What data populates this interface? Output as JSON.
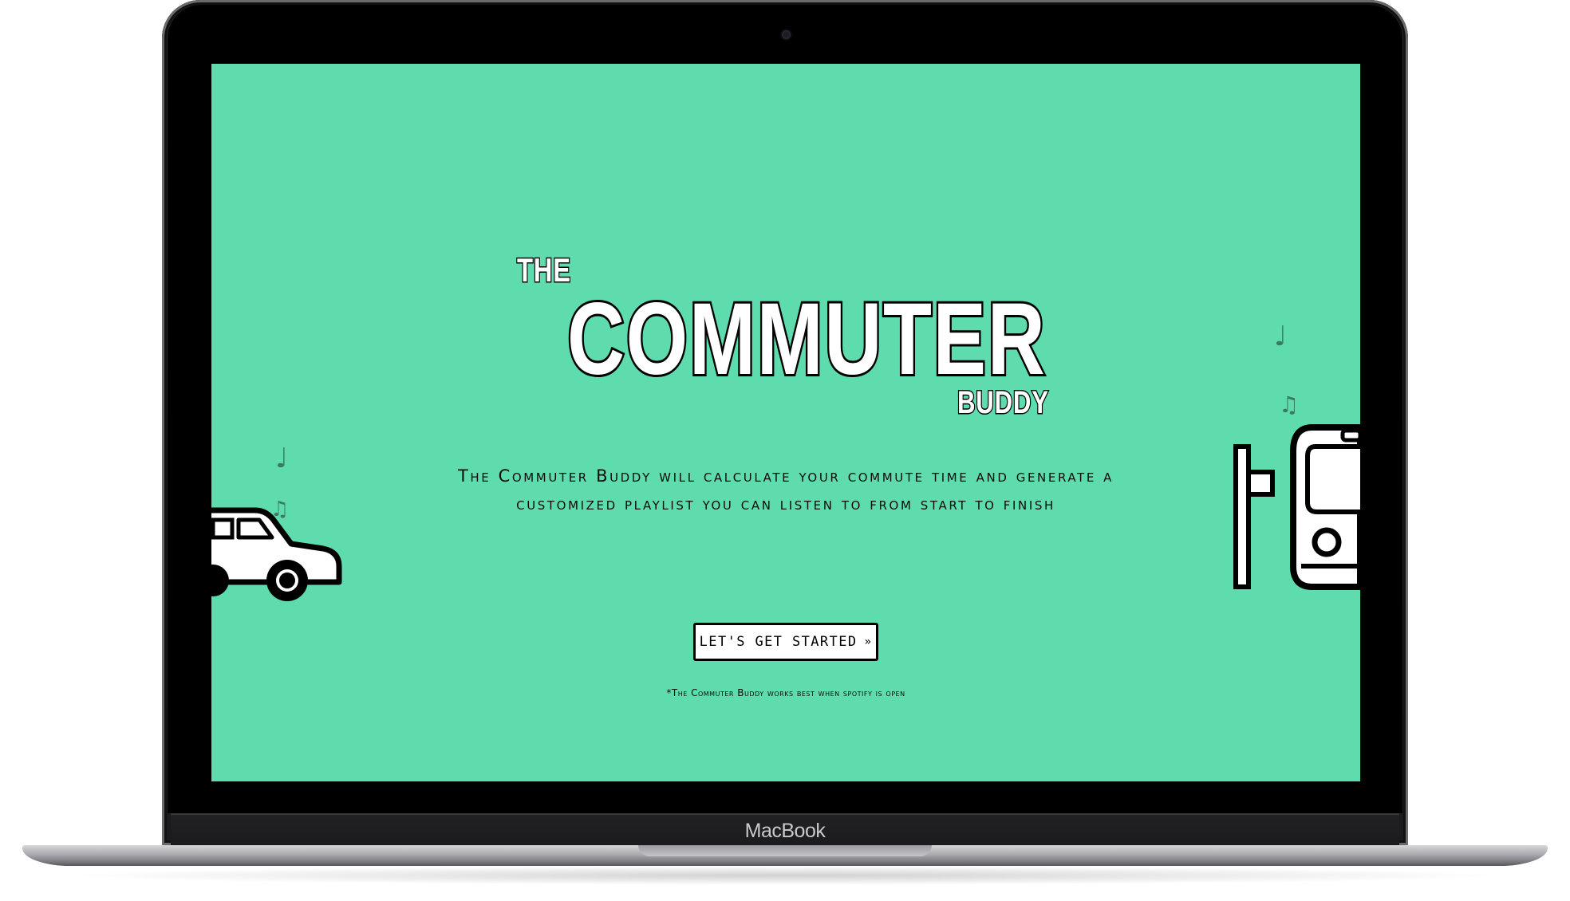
{
  "device": {
    "brand": "MacBook"
  },
  "page": {
    "logo": {
      "the": "THE",
      "commuter": "COMMUTER",
      "buddy": "BUDDY"
    },
    "tagline_line1": "The Commuter Buddy will calculate your commute time and generate a",
    "tagline_line2": "customized playlist you can listen to from start to finish",
    "cta_label": "LET'S GET STARTED",
    "cta_icon": "double-chevron-down-icon",
    "footnote": "*The Commuter Buddy works best when spotify is open",
    "background_color": "#5fdcae",
    "decor": {
      "left_icons": [
        "music-note-icon",
        "music-notes-icon",
        "car-icon"
      ],
      "right_icons": [
        "music-note-icon",
        "music-notes-icon",
        "bus-stop-icon",
        "bus-icon"
      ]
    }
  }
}
